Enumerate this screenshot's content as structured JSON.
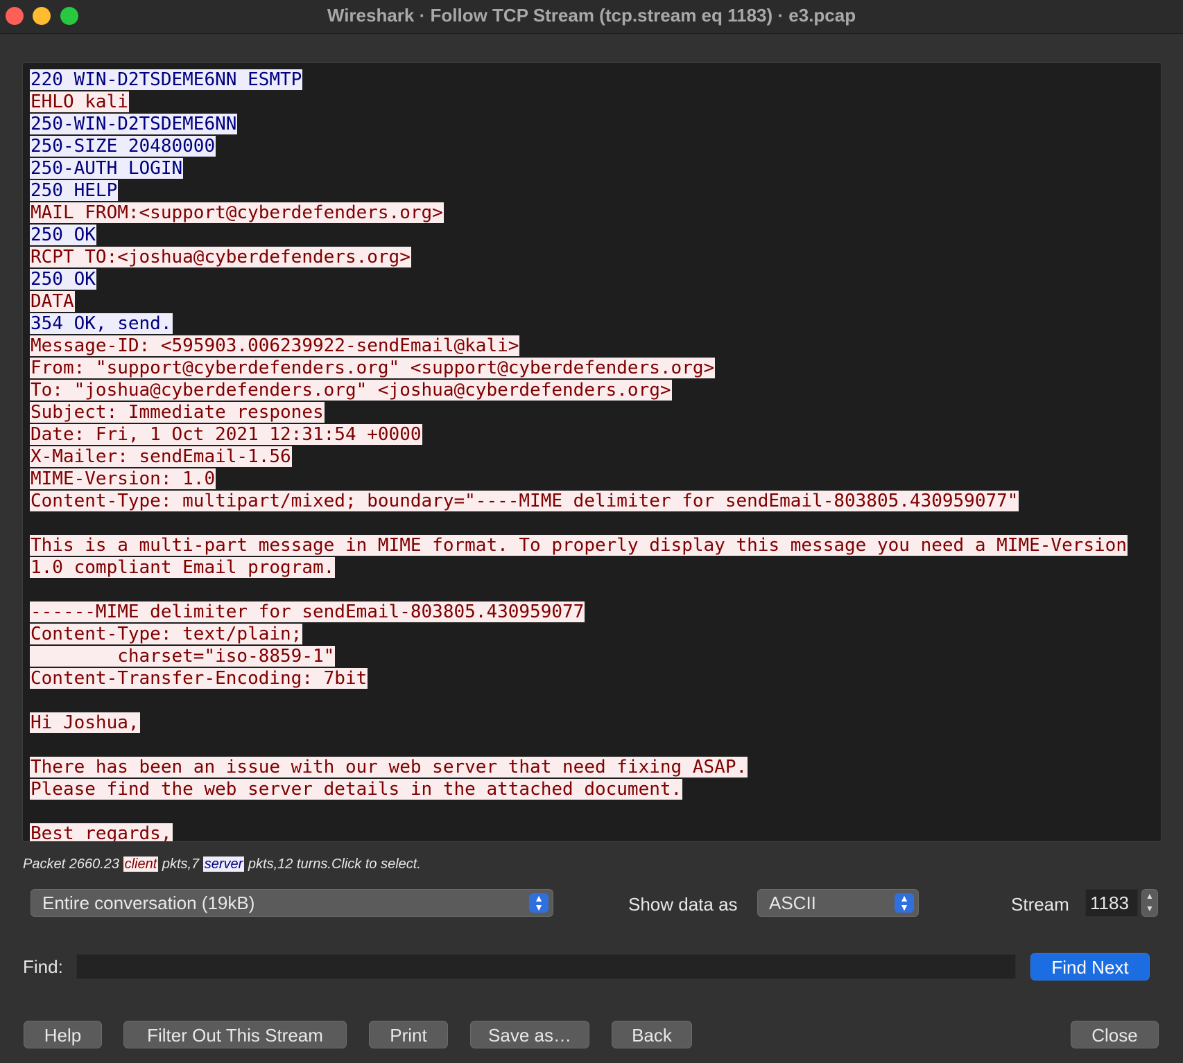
{
  "window": {
    "title": "Wireshark · Follow TCP Stream (tcp.stream eq 1183) · e3.pcap"
  },
  "stream": {
    "lines": [
      [
        {
          "t": "220 WIN-D2TSDEME6NN ESMTP",
          "r": "server"
        }
      ],
      [
        {
          "t": "EHLO kali",
          "r": "client"
        }
      ],
      [
        {
          "t": "250-WIN-D2TSDEME6NN",
          "r": "server"
        }
      ],
      [
        {
          "t": "250-SIZE 20480000",
          "r": "server"
        }
      ],
      [
        {
          "t": "250-AUTH LOGIN",
          "r": "server"
        }
      ],
      [
        {
          "t": "250 HELP",
          "r": "server"
        }
      ],
      [
        {
          "t": "MAIL FROM:<support@cyberdefenders.org>",
          "r": "client"
        }
      ],
      [
        {
          "t": "250 OK",
          "r": "server"
        }
      ],
      [
        {
          "t": "RCPT TO:<joshua@cyberdefenders.org>",
          "r": "client"
        }
      ],
      [
        {
          "t": "250 OK",
          "r": "server"
        }
      ],
      [
        {
          "t": "DATA",
          "r": "client"
        }
      ],
      [
        {
          "t": "354 OK, send.",
          "r": "server"
        }
      ],
      [
        {
          "t": "Message-ID: <595903.006239922-sendEmail@kali>",
          "r": "client"
        }
      ],
      [
        {
          "t": "From: \"support@cyberdefenders.org\" <support@cyberdefenders.org>",
          "r": "client"
        }
      ],
      [
        {
          "t": "To: \"joshua@cyberdefenders.org\" <joshua@cyberdefenders.org>",
          "r": "client"
        }
      ],
      [
        {
          "t": "Subject: Immediate respones",
          "r": "client"
        }
      ],
      [
        {
          "t": "Date: Fri, 1 Oct 2021 12:31:54 +0000",
          "r": "client"
        }
      ],
      [
        {
          "t": "X-Mailer: sendEmail-1.56",
          "r": "client"
        }
      ],
      [
        {
          "t": "MIME-Version: 1.0",
          "r": "client"
        }
      ],
      [
        {
          "t": "Content-Type: multipart/mixed; boundary=\"----MIME delimiter for sendEmail-803805.430959077\"",
          "r": "client"
        }
      ],
      [],
      [
        {
          "t": "This is a multi-part message in MIME format. To properly display this message you need a MIME-Version",
          "r": "client"
        }
      ],
      [
        {
          "t": "1.0 compliant Email program.",
          "r": "client"
        }
      ],
      [],
      [
        {
          "t": "------MIME delimiter for sendEmail-803805.430959077",
          "r": "client"
        }
      ],
      [
        {
          "t": "Content-Type: text/plain;",
          "r": "client"
        }
      ],
      [
        {
          "t": "        charset=\"iso-8859-1\"",
          "r": "client"
        }
      ],
      [
        {
          "t": "Content-Transfer-Encoding: 7bit",
          "r": "client"
        }
      ],
      [],
      [
        {
          "t": "Hi Joshua,",
          "r": "client"
        }
      ],
      [],
      [
        {
          "t": "There has been an issue with our web server that need fixing ASAP.",
          "r": "client"
        }
      ],
      [
        {
          "t": "Please find the web server details in the attached document.",
          "r": "client"
        }
      ],
      [],
      [
        {
          "t": "Best regards,",
          "r": "client"
        }
      ]
    ]
  },
  "packet_info": {
    "prefix": "Packet 2660.23 ",
    "client_tag": "client",
    "mid1": " pkts,7 ",
    "server_tag": "server",
    "suffix": " pkts,12 turns.Click to select."
  },
  "controls": {
    "conversation_select": "Entire conversation (19kB)",
    "show_data_label": "Show data as",
    "show_data_select": "ASCII",
    "stream_label": "Stream",
    "stream_value": "1183",
    "find_label": "Find:",
    "find_value": "",
    "find_next": "Find Next"
  },
  "buttons": {
    "help": "Help",
    "filter_out": "Filter Out This Stream",
    "print": "Print",
    "save_as": "Save as…",
    "back": "Back",
    "close": "Close"
  },
  "colors": {
    "client_bg": "#fbeded",
    "client_fg": "#7f0000",
    "server_bg": "#ededfb",
    "server_fg": "#00007f",
    "accent": "#1c6de1"
  }
}
